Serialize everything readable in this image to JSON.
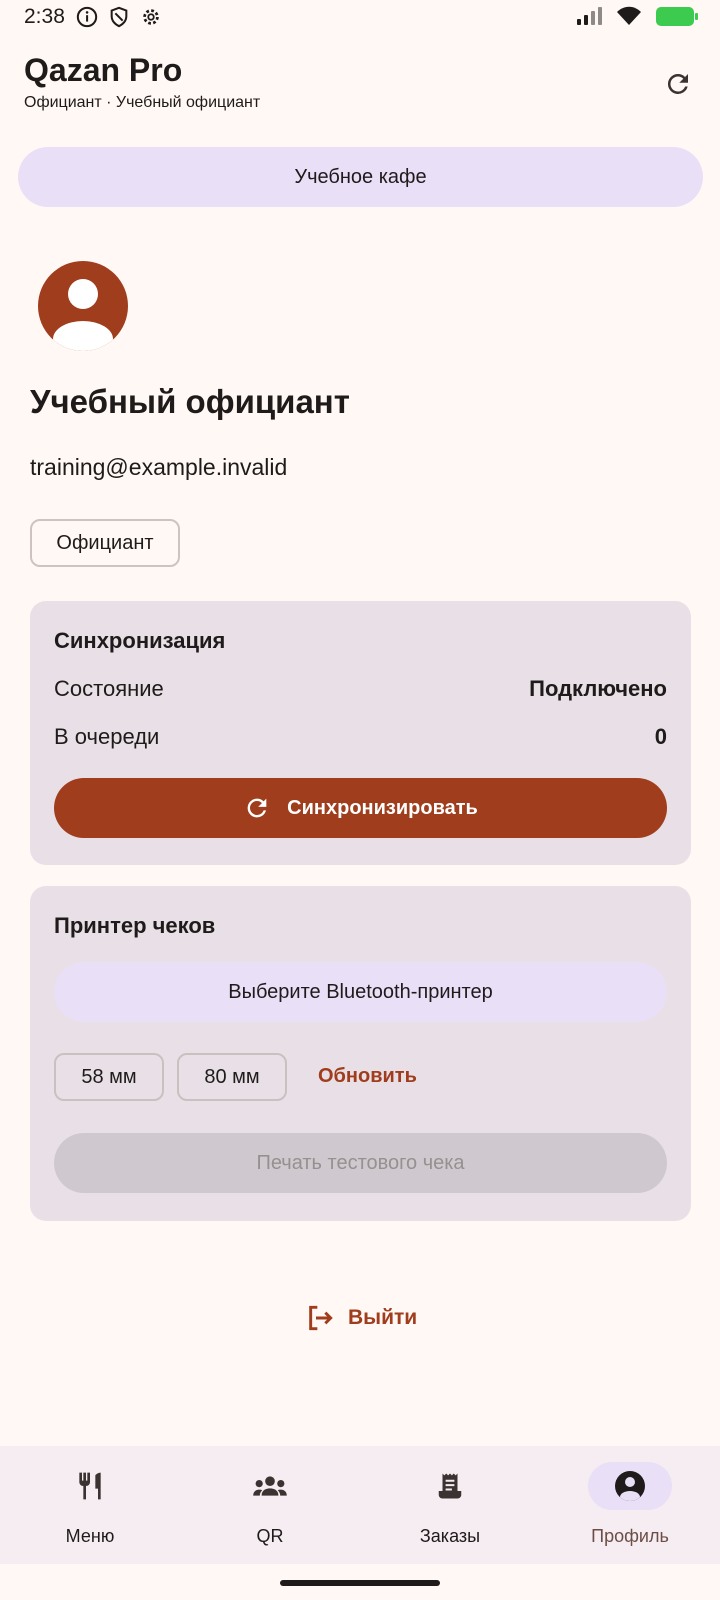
{
  "status_bar": {
    "time": "2:38",
    "icons_left": [
      "info-icon",
      "shield-icon",
      "settings-icon"
    ],
    "icons_right": [
      "signal-icon",
      "wifi-icon",
      "battery-charging-icon"
    ]
  },
  "header": {
    "title": "Qazan Pro",
    "subtitle": "Официант · Учебный официант",
    "refresh_icon": "refresh-icon"
  },
  "cafe": {
    "name": "Учебное кафе"
  },
  "profile": {
    "name": "Учебный официант",
    "email": "training@example.invalid",
    "role": "Официант"
  },
  "sync": {
    "title": "Синхронизация",
    "state_label": "Состояние",
    "state_value": "Подключено",
    "queue_label": "В очереди",
    "queue_value": "0",
    "button_label": "Синхронизировать"
  },
  "printer": {
    "title": "Принтер чеков",
    "select_label": "Выберите Bluetooth-принтер",
    "width_58": "58 мм",
    "width_80": "80 мм",
    "refresh_label": "Обновить",
    "test_print_label": "Печать тестового чека"
  },
  "logout": {
    "label": "Выйти"
  },
  "nav": {
    "items": [
      {
        "label": "Меню",
        "icon": "restaurant-icon"
      },
      {
        "label": "QR",
        "icon": "group-icon"
      },
      {
        "label": "Заказы",
        "icon": "receipt-icon"
      },
      {
        "label": "Профиль",
        "icon": "account-icon"
      }
    ],
    "active_index": 3
  },
  "colors": {
    "background": "#FFF8F5",
    "primary": "#9F3D1C",
    "tonal": "#E9DFF7",
    "card": "#E8E0E6",
    "battery": "#3DCB4F"
  }
}
